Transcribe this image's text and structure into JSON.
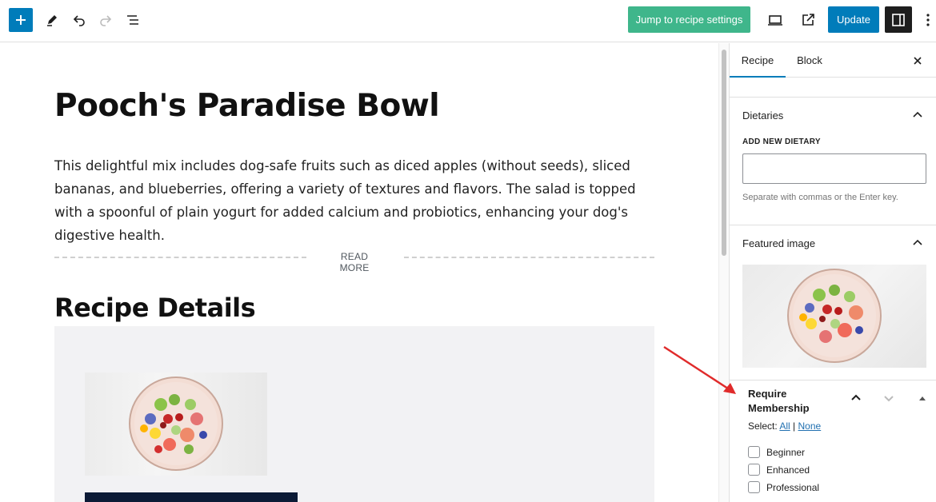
{
  "toolbar": {
    "jump_label": "Jump to recipe settings",
    "update_label": "Update",
    "icons": [
      "plus-icon",
      "pencil-icon",
      "undo-icon",
      "redo-icon",
      "list-view-icon",
      "preview-icon",
      "external-link-icon",
      "sidebar-icon",
      "more-icon"
    ]
  },
  "post": {
    "title": "Pooch's Paradise Bowl",
    "excerpt": "This delightful mix includes dog-safe fruits such as diced apples (without seeds), sliced bananas, and blueberries, offering a variety of textures and flavors. The salad is topped with a spoonful of plain yogurt for added calcium and probiotics, enhancing your dog's digestive health.",
    "read_more": "READ MORE",
    "section_title": "Recipe Details"
  },
  "sidebar": {
    "tabs": [
      "Recipe",
      "Block"
    ],
    "dietaries": {
      "title": "Dietaries",
      "field_label": "ADD NEW DIETARY",
      "input_value": "",
      "help": "Separate with commas or the Enter key."
    },
    "featured": {
      "title": "Featured image"
    },
    "membership": {
      "title": "Require Membership",
      "select_label": "Select:",
      "all": "All",
      "separator": "|",
      "none": "None",
      "options": [
        "Beginner",
        "Enhanced",
        "Professional"
      ]
    }
  },
  "colors": {
    "accent": "#007cba",
    "jump_button": "#3fb68b",
    "annotation_arrow": "#e02b2b"
  }
}
